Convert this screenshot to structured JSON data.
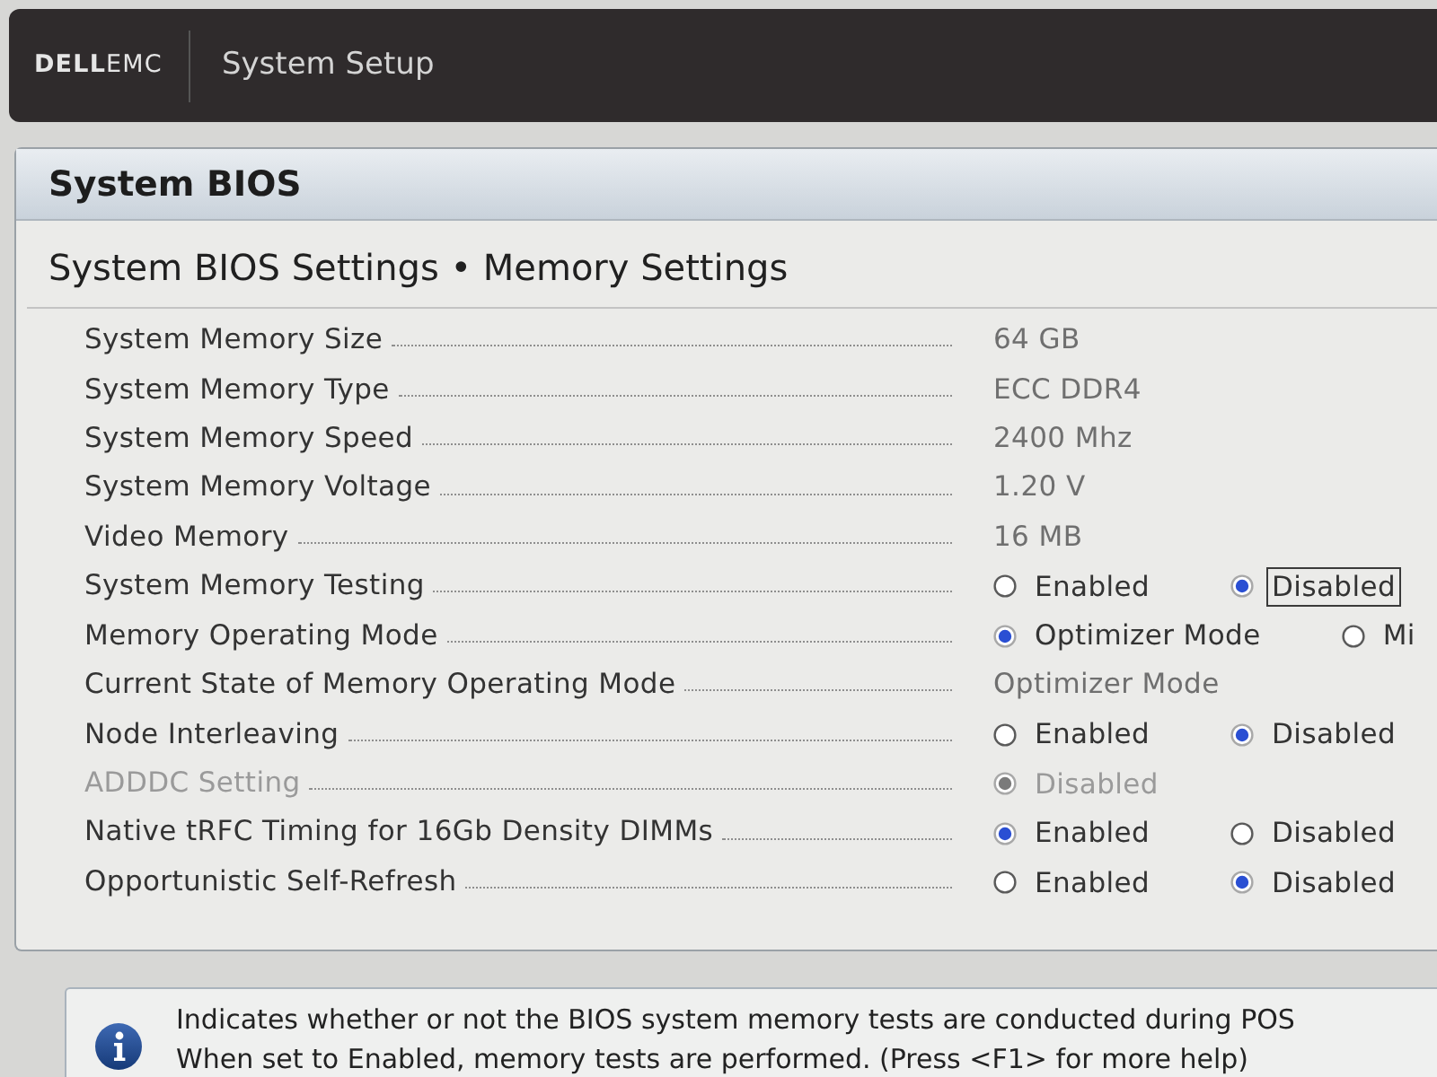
{
  "header": {
    "logo": "**DELL**EMC",
    "title": "System Setup"
  },
  "panel": {
    "title": "System BIOS",
    "breadcrumb": "System BIOS Settings • Memory Settings"
  },
  "settings": [
    {
      "kind": "value",
      "label": "System Memory Size",
      "value": "64 GB",
      "disabled": false
    },
    {
      "kind": "value",
      "label": "System Memory Type",
      "value": "ECC DDR4",
      "disabled": false
    },
    {
      "kind": "value",
      "label": "System Memory Speed",
      "value": "2400 Mhz",
      "disabled": false
    },
    {
      "kind": "value",
      "label": "System Memory Voltage",
      "value": "1.20 V",
      "disabled": false
    },
    {
      "kind": "value",
      "label": "Video Memory",
      "value": "16 MB",
      "disabled": false
    },
    {
      "kind": "radio",
      "label": "System Memory Testing",
      "disabled": false,
      "options": [
        {
          "label": "Enabled",
          "selected": false,
          "focused": false
        },
        {
          "label": "Disabled",
          "selected": true,
          "focused": true
        }
      ]
    },
    {
      "kind": "radio",
      "label": "Memory Operating Mode",
      "disabled": false,
      "options": [
        {
          "label": "Optimizer Mode",
          "selected": true,
          "focused": false
        },
        {
          "label": "Mi",
          "selected": false,
          "focused": false
        }
      ]
    },
    {
      "kind": "value",
      "label": "Current State of Memory Operating Mode",
      "value": "Optimizer Mode",
      "disabled": false
    },
    {
      "kind": "radio",
      "label": "Node Interleaving",
      "disabled": false,
      "options": [
        {
          "label": "Enabled",
          "selected": false,
          "focused": false
        },
        {
          "label": "Disabled",
          "selected": true,
          "focused": false
        }
      ]
    },
    {
      "kind": "radio",
      "label": "ADDDC Setting",
      "disabled": true,
      "options": [
        {
          "label": "Disabled",
          "selected": true,
          "focused": false
        }
      ]
    },
    {
      "kind": "radio",
      "label": "Native tRFC Timing for 16Gb Density DIMMs",
      "disabled": false,
      "options": [
        {
          "label": "Enabled",
          "selected": true,
          "focused": false
        },
        {
          "label": "Disabled",
          "selected": false,
          "focused": false
        }
      ]
    },
    {
      "kind": "radio",
      "label": "Opportunistic Self-Refresh",
      "disabled": false,
      "options": [
        {
          "label": "Enabled",
          "selected": false,
          "focused": false
        },
        {
          "label": "Disabled",
          "selected": true,
          "focused": false
        }
      ]
    }
  ],
  "help": {
    "lines": [
      "Indicates whether or not the BIOS system memory tests are conducted during POS",
      "When set to Enabled, memory tests are performed. (Press <F1> for more help)"
    ]
  }
}
